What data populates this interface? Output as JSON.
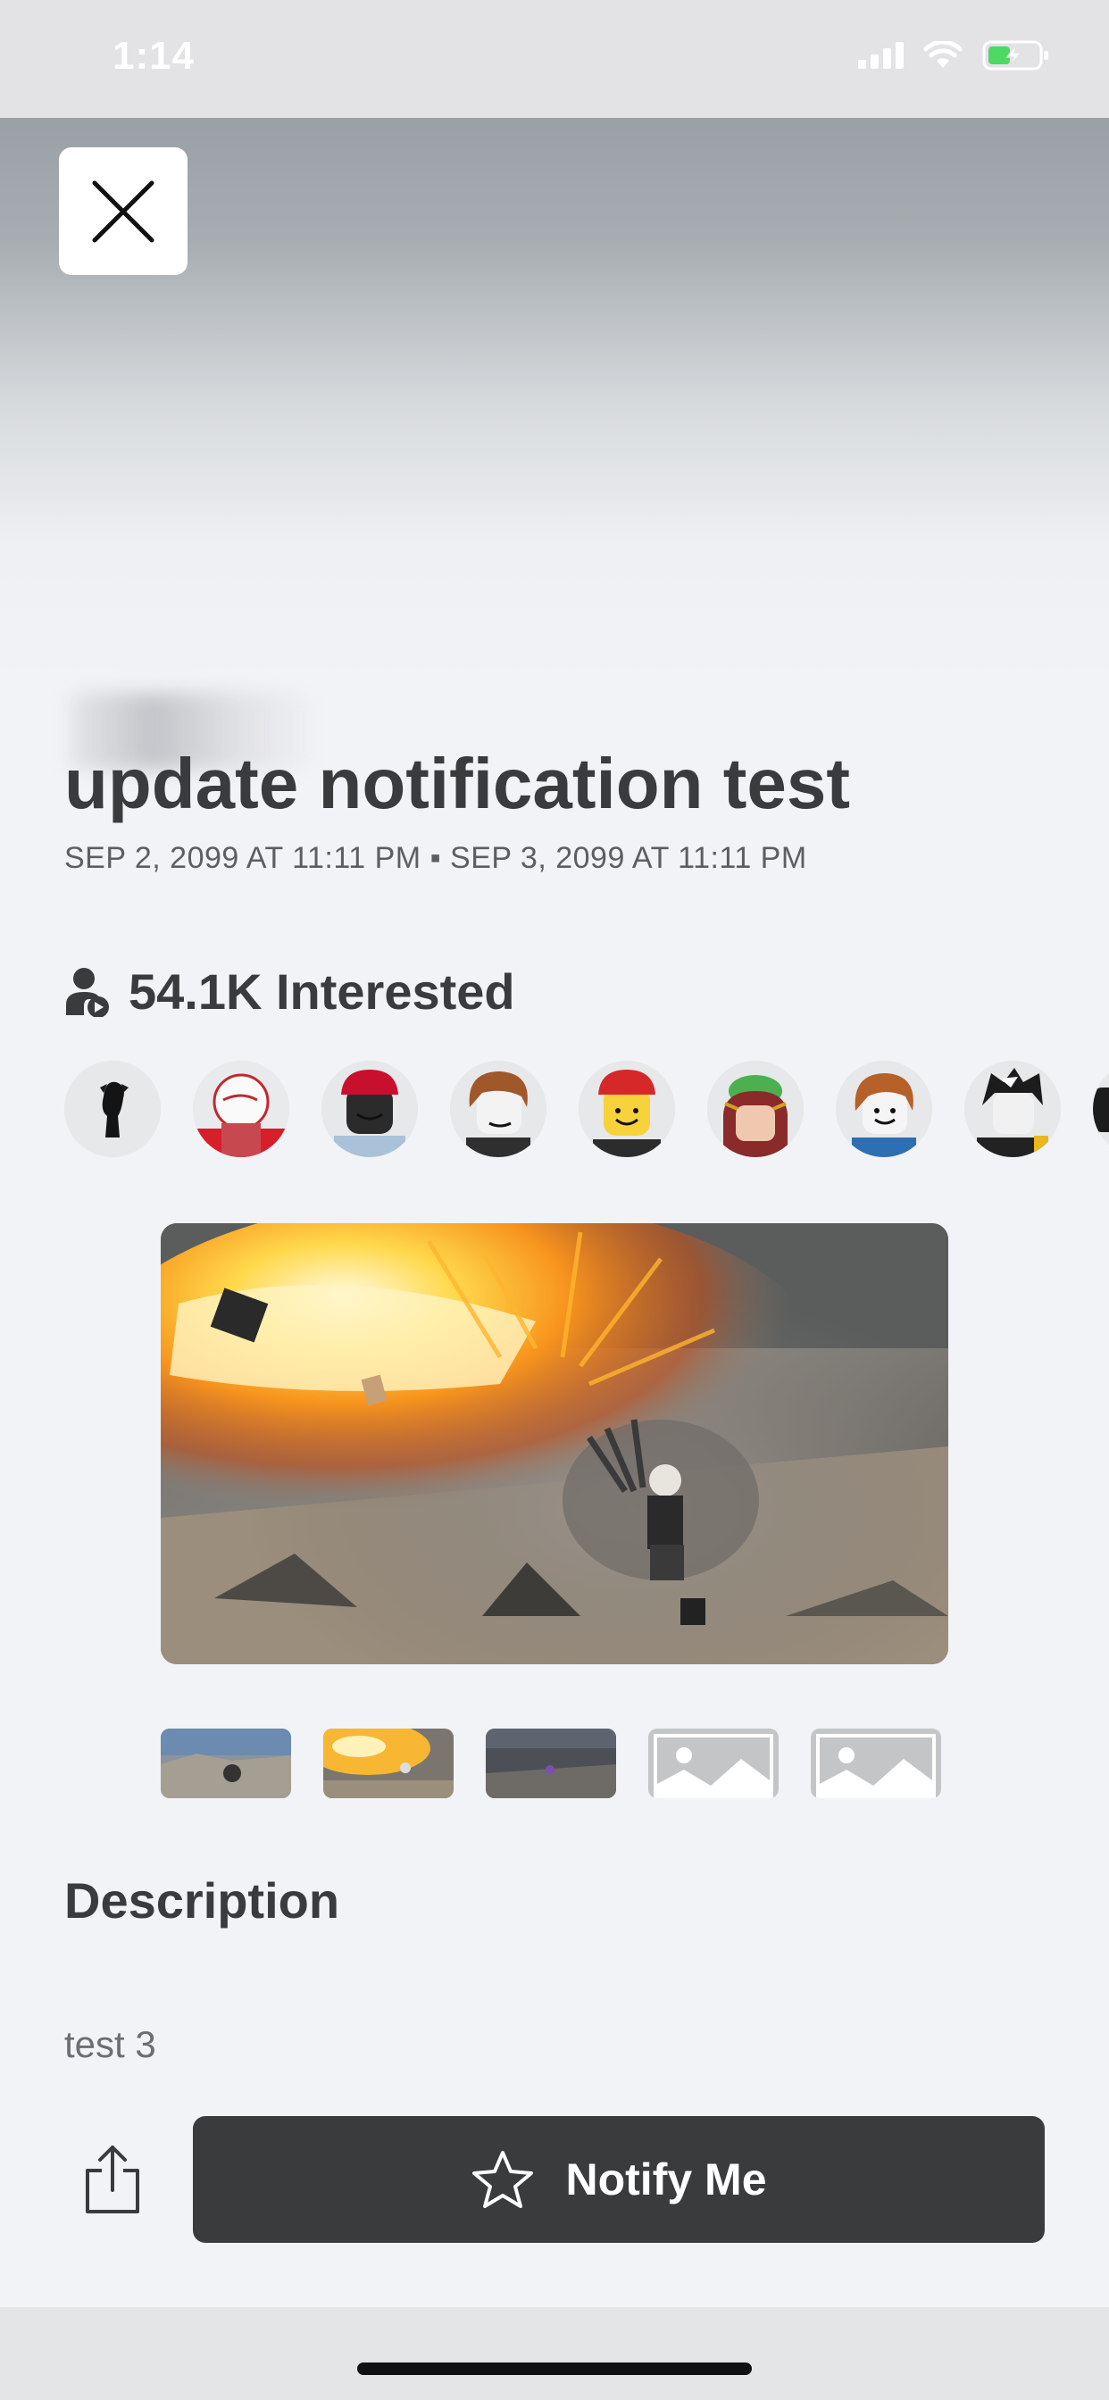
{
  "status_bar": {
    "time": "1:14"
  },
  "event": {
    "title": "update notification test",
    "dates": "SEP 2, 2099 AT 11:11 PM ▪ SEP 3, 2099 AT 11:11 PM",
    "interested_count": "54.1K Interested"
  },
  "attendees": [
    {
      "icon": "avatar-dark-silhouette"
    },
    {
      "icon": "avatar-red-white"
    },
    {
      "icon": "avatar-red-cap"
    },
    {
      "icon": "avatar-brown-hair"
    },
    {
      "icon": "avatar-red-cap-smile"
    },
    {
      "icon": "avatar-frog-hat"
    },
    {
      "icon": "avatar-brown-hair-smile"
    },
    {
      "icon": "avatar-black-white-hair"
    },
    {
      "icon": "avatar-partial"
    }
  ],
  "gallery": {
    "thumbnails": [
      {
        "type": "screenshot",
        "icon": "image-thumbnail"
      },
      {
        "type": "screenshot",
        "icon": "image-thumbnail"
      },
      {
        "type": "screenshot",
        "icon": "image-thumbnail"
      },
      {
        "type": "placeholder",
        "icon": "image-placeholder-icon"
      },
      {
        "type": "placeholder",
        "icon": "image-placeholder-icon"
      }
    ]
  },
  "description": {
    "heading": "Description",
    "text": "test 3"
  },
  "actions": {
    "notify_label": "Notify Me",
    "notify_icon": "star-outline-icon",
    "share_icon": "share-icon",
    "close_icon": "close-icon"
  },
  "colors": {
    "button_dark": "#393b3d",
    "page_background": "#f2f3f6",
    "text_primary": "#393b3d"
  }
}
